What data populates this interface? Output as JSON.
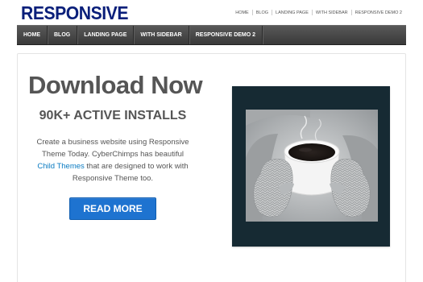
{
  "site": {
    "logo": "RESPONSIVE"
  },
  "top_menu": {
    "items": [
      {
        "label": "HOME"
      },
      {
        "label": "BLOG"
      },
      {
        "label": "LANDING PAGE"
      },
      {
        "label": "WITH SIDEBAR"
      },
      {
        "label": "RESPONSIVE DEMO 2"
      }
    ]
  },
  "main_nav": {
    "items": [
      {
        "label": "HOME"
      },
      {
        "label": "BLOG"
      },
      {
        "label": "LANDING PAGE"
      },
      {
        "label": "WITH SIDEBAR"
      },
      {
        "label": "RESPONSIVE DEMO 2"
      }
    ]
  },
  "hero": {
    "title": "Download Now",
    "subtitle": "90K+ ACTIVE INSTALLS",
    "text_before_link": "Create a business website using Responsive Theme Today. CyberChimps has beautiful ",
    "link_text": "Child Themes",
    "text_after_link": " that are designed to work with Responsive Theme too.",
    "button_label": "READ MORE"
  },
  "colors": {
    "logo": "#0a1f7a",
    "nav_bg": "#4a4a4a",
    "button": "#1e73d0",
    "link": "#0a7bc2",
    "heading": "#555555"
  }
}
